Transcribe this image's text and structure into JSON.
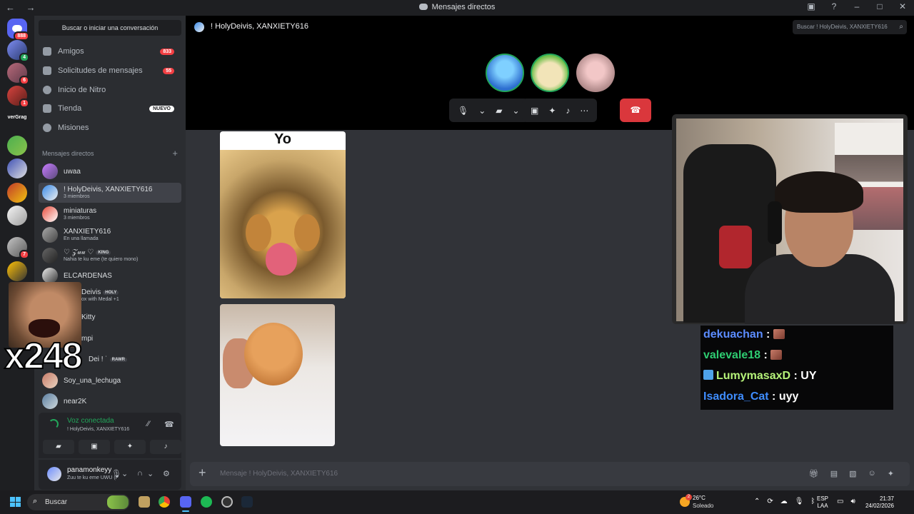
{
  "window": {
    "title": "Mensajes directos",
    "nav_arrows": "← →"
  },
  "sidebar": {
    "search_label": "Buscar o iniciar una conversación",
    "nav_items": [
      {
        "label": "Amigos",
        "count": "833"
      },
      {
        "label": "Solicitudes de mensajes",
        "count": "55"
      },
      {
        "label": "Inicio de Nitro"
      },
      {
        "label": "Tienda",
        "tag": "NUEVO"
      },
      {
        "label": "Misiones"
      }
    ],
    "dm_header": "Mensajes directos",
    "dms": [
      {
        "name": "uwaa",
        "sub": ""
      },
      {
        "name": "! HolyDeivis, XANXIETY616",
        "sub": "3 miembros"
      },
      {
        "name": "miniaturas",
        "sub": "3 miembros"
      },
      {
        "name": "XANXIETY616",
        "sub": "En una llamada"
      },
      {
        "name": "♡ 𝒵𝓊𝓊 ♡",
        "tag": "KING",
        "sub": "Nahia te ku eme (te quiero mono)"
      },
      {
        "name": "ELCARDENAS",
        "sub": ""
      },
      {
        "name": "Deivis",
        "tag": "HOLY",
        "sub": "ox with Medal +1"
      },
      {
        "name": "Kitty",
        "sub": ""
      },
      {
        "name": "mpi",
        "sub": ""
      },
      {
        "name": "Dei ! ˙",
        "tag": "RAWR",
        "sub": ""
      },
      {
        "name": "Soy_una_lechuga",
        "sub": ""
      },
      {
        "name": "near2K",
        "sub": ""
      }
    ],
    "server_badges": {
      "home": "888",
      "s1": "4",
      "s2": "6",
      "s3": "1",
      "s4": "7"
    },
    "server_label": "verGrag",
    "voice": {
      "status": "Voz conectada",
      "channel": "! HolyDeivis, XANXIETY616"
    },
    "user": {
      "name": "panamonkeyy",
      "status": "Zuu te ku eme UWU (I"
    }
  },
  "main": {
    "channel_title": "! HolyDeivis, XANXIETY616",
    "search_placeholder": "Buscar ! HolyDeivis, XANXIETY616",
    "meme_caption": "Yo",
    "message_placeholder": "Mensaje ! HolyDeivis, XANXIETY616"
  },
  "overlay": {
    "counter": "x248",
    "chat": [
      {
        "user": "dekuachan",
        "color": "#5b8cff",
        "msg": "",
        "emote": true
      },
      {
        "user": "valevale18",
        "color": "#2ecc71",
        "msg": "",
        "emote": true
      },
      {
        "user": "LumymasaxD",
        "color": "#b6f37a",
        "msg": "UY",
        "badge": true
      },
      {
        "user": "Isadora_Cat",
        "color": "#3f8dff",
        "msg": "uyy"
      }
    ]
  },
  "taskbar": {
    "search": "Buscar",
    "weather_temp": "26°C",
    "weather_cond": "Soleado",
    "weather_badge": "2",
    "lang_1": "ESP",
    "lang_2": "LAA",
    "time": "21:37",
    "date": "24/02/2026"
  },
  "colors": {
    "accent": "#5865f2",
    "danger": "#da373c",
    "online": "#23a55a",
    "bg_chat": "#313338",
    "bg_sidebar": "#2b2d31"
  }
}
